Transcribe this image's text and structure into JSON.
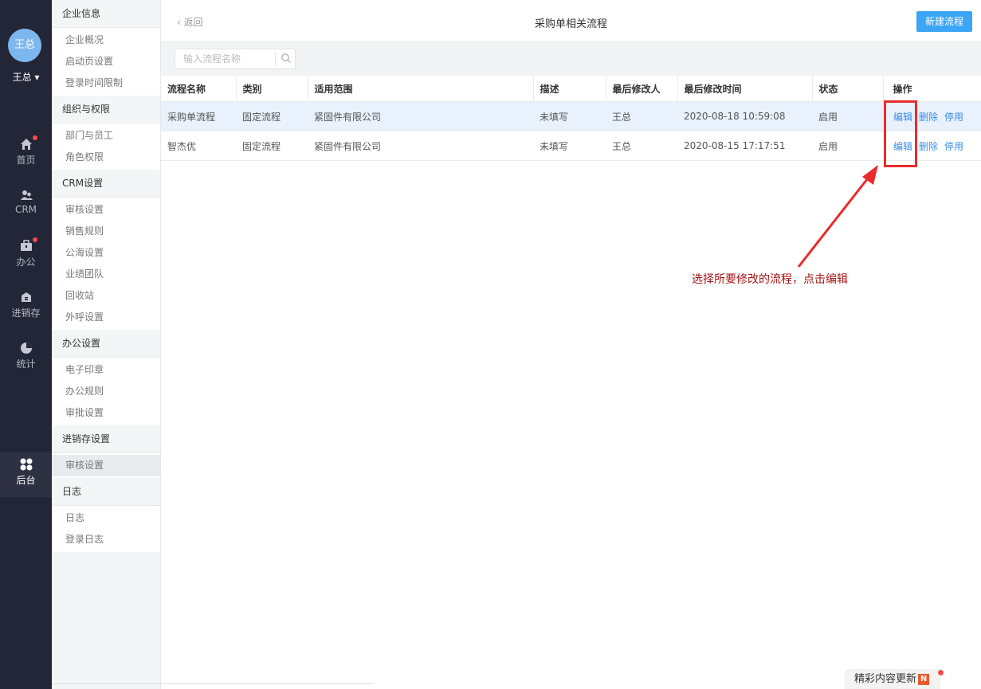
{
  "nav": {
    "avatar": "王总",
    "user": "王总 ▾",
    "items": [
      {
        "label": "首页",
        "icon": "home-icon"
      },
      {
        "label": "CRM",
        "icon": "people-icon"
      },
      {
        "label": "办公",
        "icon": "briefcase-icon"
      },
      {
        "label": "进销存",
        "icon": "inventory-icon"
      },
      {
        "label": "统计",
        "icon": "pie-chart-icon"
      },
      {
        "label": "后台",
        "icon": "grid-icon"
      }
    ]
  },
  "menu": {
    "groups": [
      {
        "title": "企业信息",
        "items": [
          "企业概况",
          "启动页设置",
          "登录时间限制"
        ]
      },
      {
        "title": "组织与权限",
        "items": [
          "部门与员工",
          "角色权限"
        ]
      },
      {
        "title": "CRM设置",
        "items": [
          "审核设置",
          "销售规则",
          "公海设置",
          "业绩团队",
          "回收站",
          "外呼设置"
        ]
      },
      {
        "title": "办公设置",
        "items": [
          "电子印章",
          "办公规则",
          "审批设置"
        ]
      },
      {
        "title": "进销存设置",
        "items": [
          "审核设置"
        ]
      },
      {
        "title": "日志",
        "items": [
          "日志",
          "登录日志"
        ]
      }
    ]
  },
  "header": {
    "back": "返回",
    "title": "采购单相关流程",
    "new_button": "新建流程"
  },
  "search": {
    "placeholder": "输入流程名称"
  },
  "table": {
    "columns": [
      "流程名称",
      "类别",
      "适用范围",
      "描述",
      "最后修改人",
      "最后修改时间",
      "状态",
      "操作"
    ],
    "rows": [
      {
        "name": "采购单流程",
        "category": "固定流程",
        "scope": "紧固件有限公司",
        "desc": "未填写",
        "modifier": "王总",
        "time": "2020-08-18 10:59:08",
        "status": "启用"
      },
      {
        "name": "智杰优",
        "category": "固定流程",
        "scope": "紧固件有限公司",
        "desc": "未填写",
        "modifier": "王总",
        "time": "2020-08-15 17:17:51",
        "status": "启用"
      }
    ],
    "actions": {
      "edit": "编辑",
      "delete": "删除",
      "disable": "停用"
    }
  },
  "annotation": "选择所要修改的流程，点击编辑",
  "footer": {
    "badge": "精彩内容更新",
    "badge_icon": "N"
  },
  "colors": {
    "accent": "#3aa6f5",
    "link": "#3a8ee6",
    "highlight": "#ea2b2b",
    "nav_bg": "#232636"
  }
}
